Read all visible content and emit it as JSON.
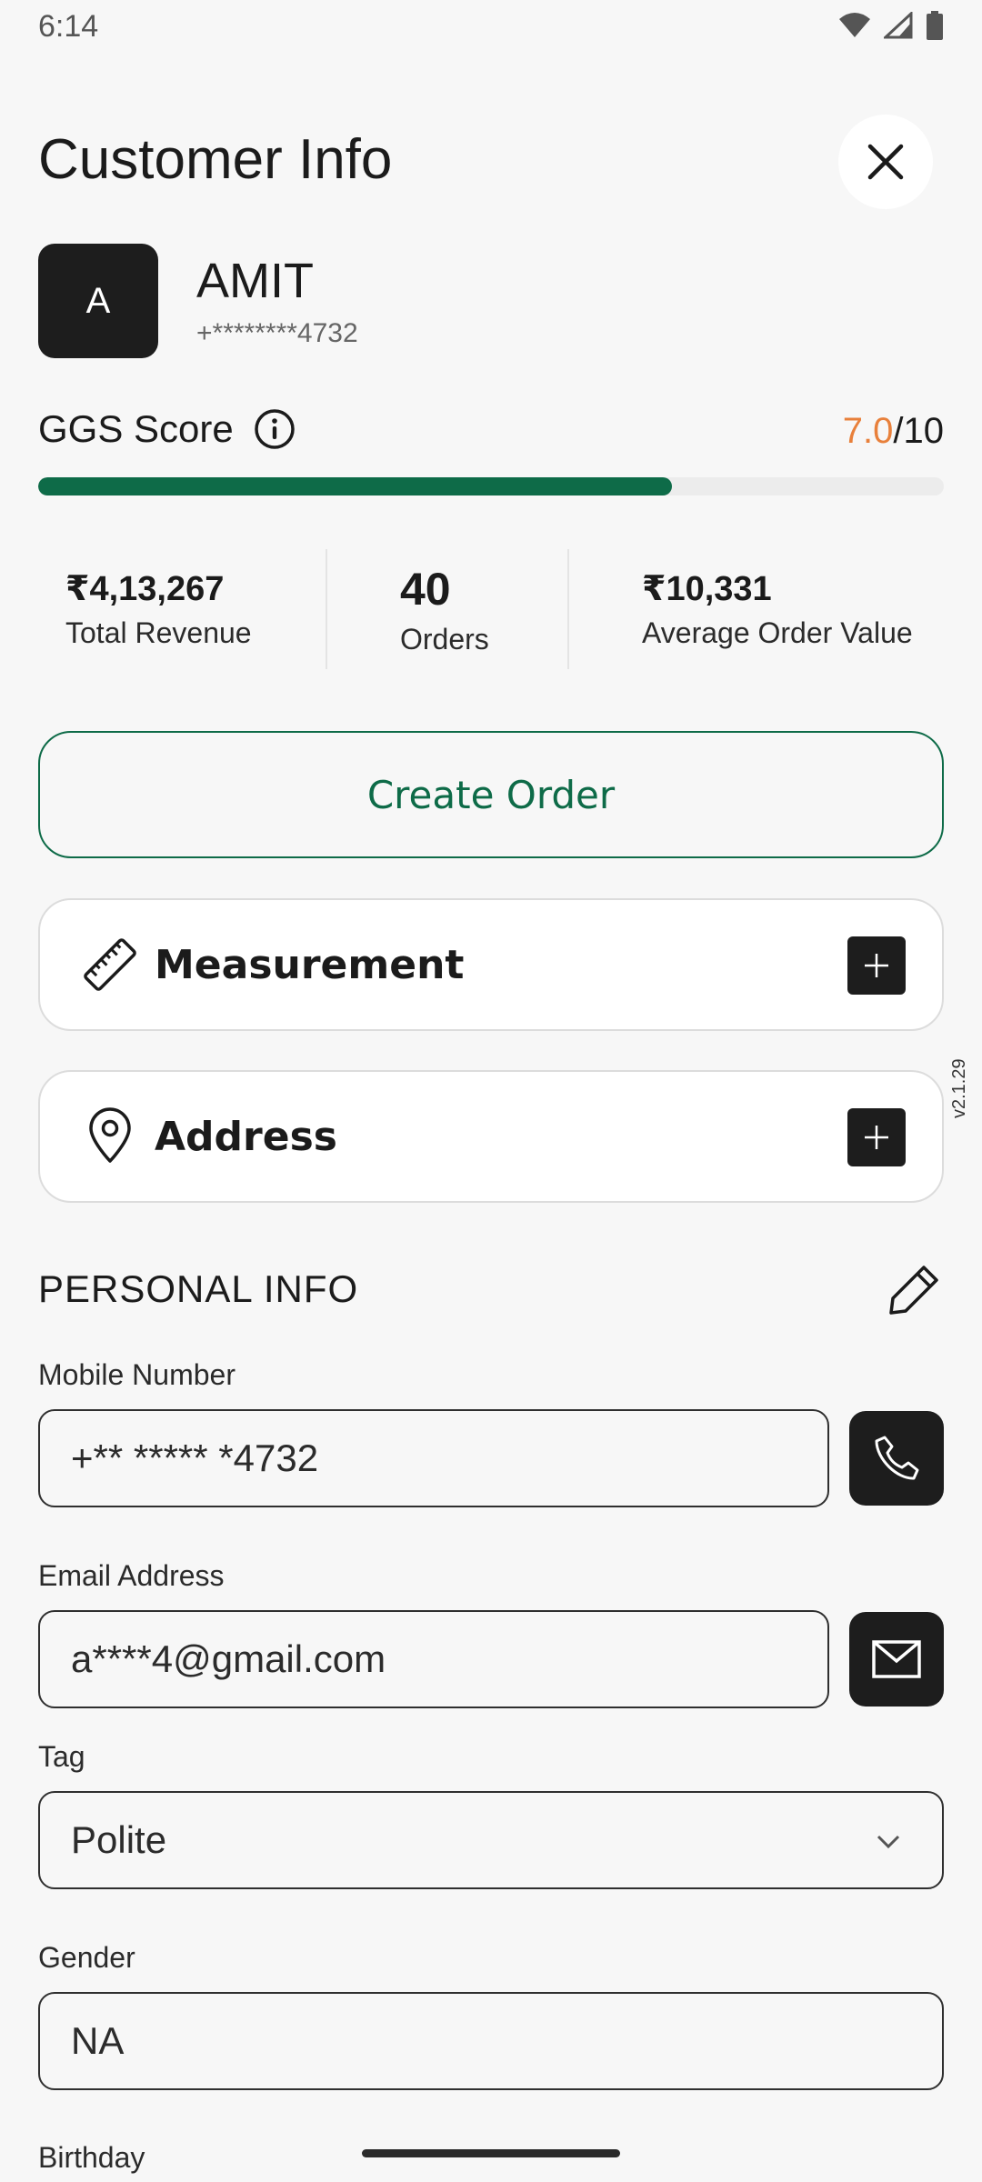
{
  "status_bar": {
    "time": "6:14"
  },
  "header": {
    "title": "Customer Info"
  },
  "customer": {
    "initial": "A",
    "name": "AMIT",
    "phone_masked": "+********4732"
  },
  "score": {
    "label": "GGS Score",
    "value": "7.0",
    "max": "/10",
    "fill_fraction": 0.7,
    "fill_color": "#0e6b48",
    "value_color": "#e8803b"
  },
  "stats": [
    {
      "value": "₹4,13,267",
      "label": "Total Revenue"
    },
    {
      "value": "40",
      "label": "Orders"
    },
    {
      "value": "₹10,331",
      "label": "Average Order Value"
    }
  ],
  "actions": {
    "create_order": "Create Order"
  },
  "cards": {
    "measurement": {
      "label": "Measurement",
      "icon": "ruler-icon"
    },
    "address": {
      "label": "Address",
      "icon": "location-pin-icon"
    }
  },
  "version": "v2.1.29",
  "personal_info": {
    "title": "PERSONAL INFO",
    "mobile": {
      "label": "Mobile Number",
      "value": "+** ***** *4732"
    },
    "email": {
      "label": "Email Address",
      "value": "a****4@gmail.com"
    },
    "tag": {
      "label": "Tag",
      "value": "Polite"
    },
    "gender": {
      "label": "Gender",
      "value": "NA"
    },
    "birthday": {
      "label": "Birthday"
    }
  },
  "colors": {
    "accent": "#0e6b48",
    "dark": "#1d1d1d",
    "background": "#f7f7f7"
  }
}
